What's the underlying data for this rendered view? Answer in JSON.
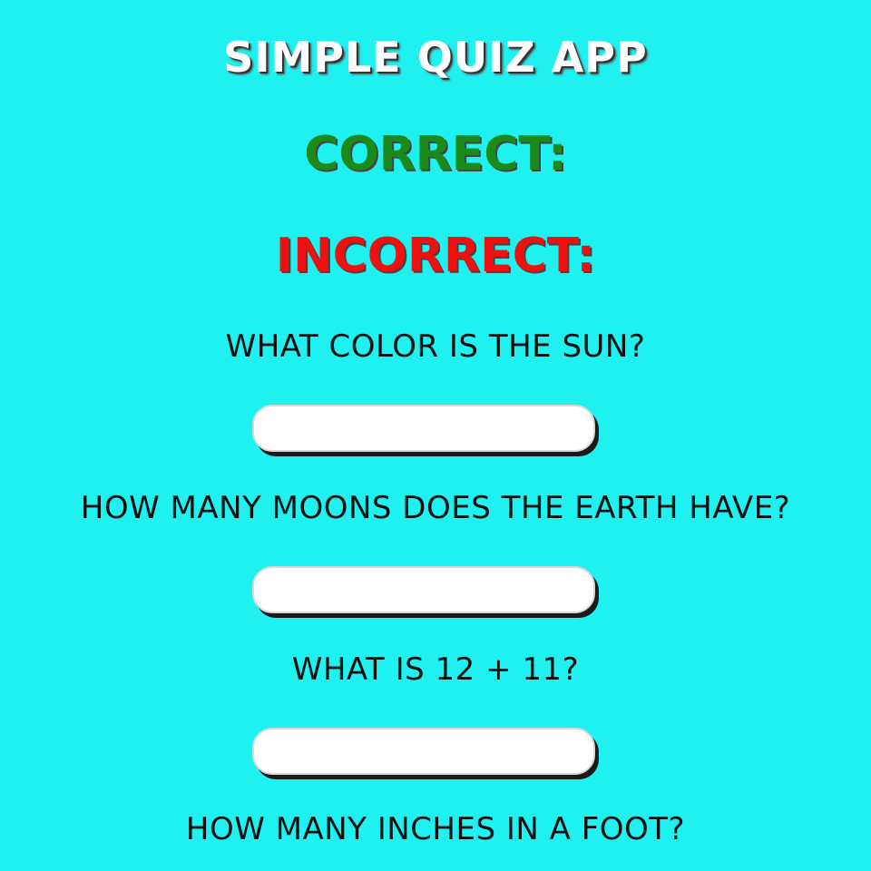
{
  "app": {
    "title": "SIMPLE QUIZ APP"
  },
  "score": {
    "correct_label": "CORRECT:",
    "incorrect_label": "INCORRECT:"
  },
  "questions": [
    {
      "text": "WHAT COLOR IS THE SUN?",
      "answer": ""
    },
    {
      "text": "HOW MANY MOONS DOES THE EARTH HAVE?",
      "answer": ""
    },
    {
      "text": "WHAT IS 12 + 11?",
      "answer": ""
    },
    {
      "text": "HOW MANY INCHES IN A FOOT?"
    }
  ],
  "colors": {
    "background": "#1ff0f0",
    "correct": "#1b8a1b",
    "incorrect": "#ee1111",
    "title": "#ffffff"
  }
}
